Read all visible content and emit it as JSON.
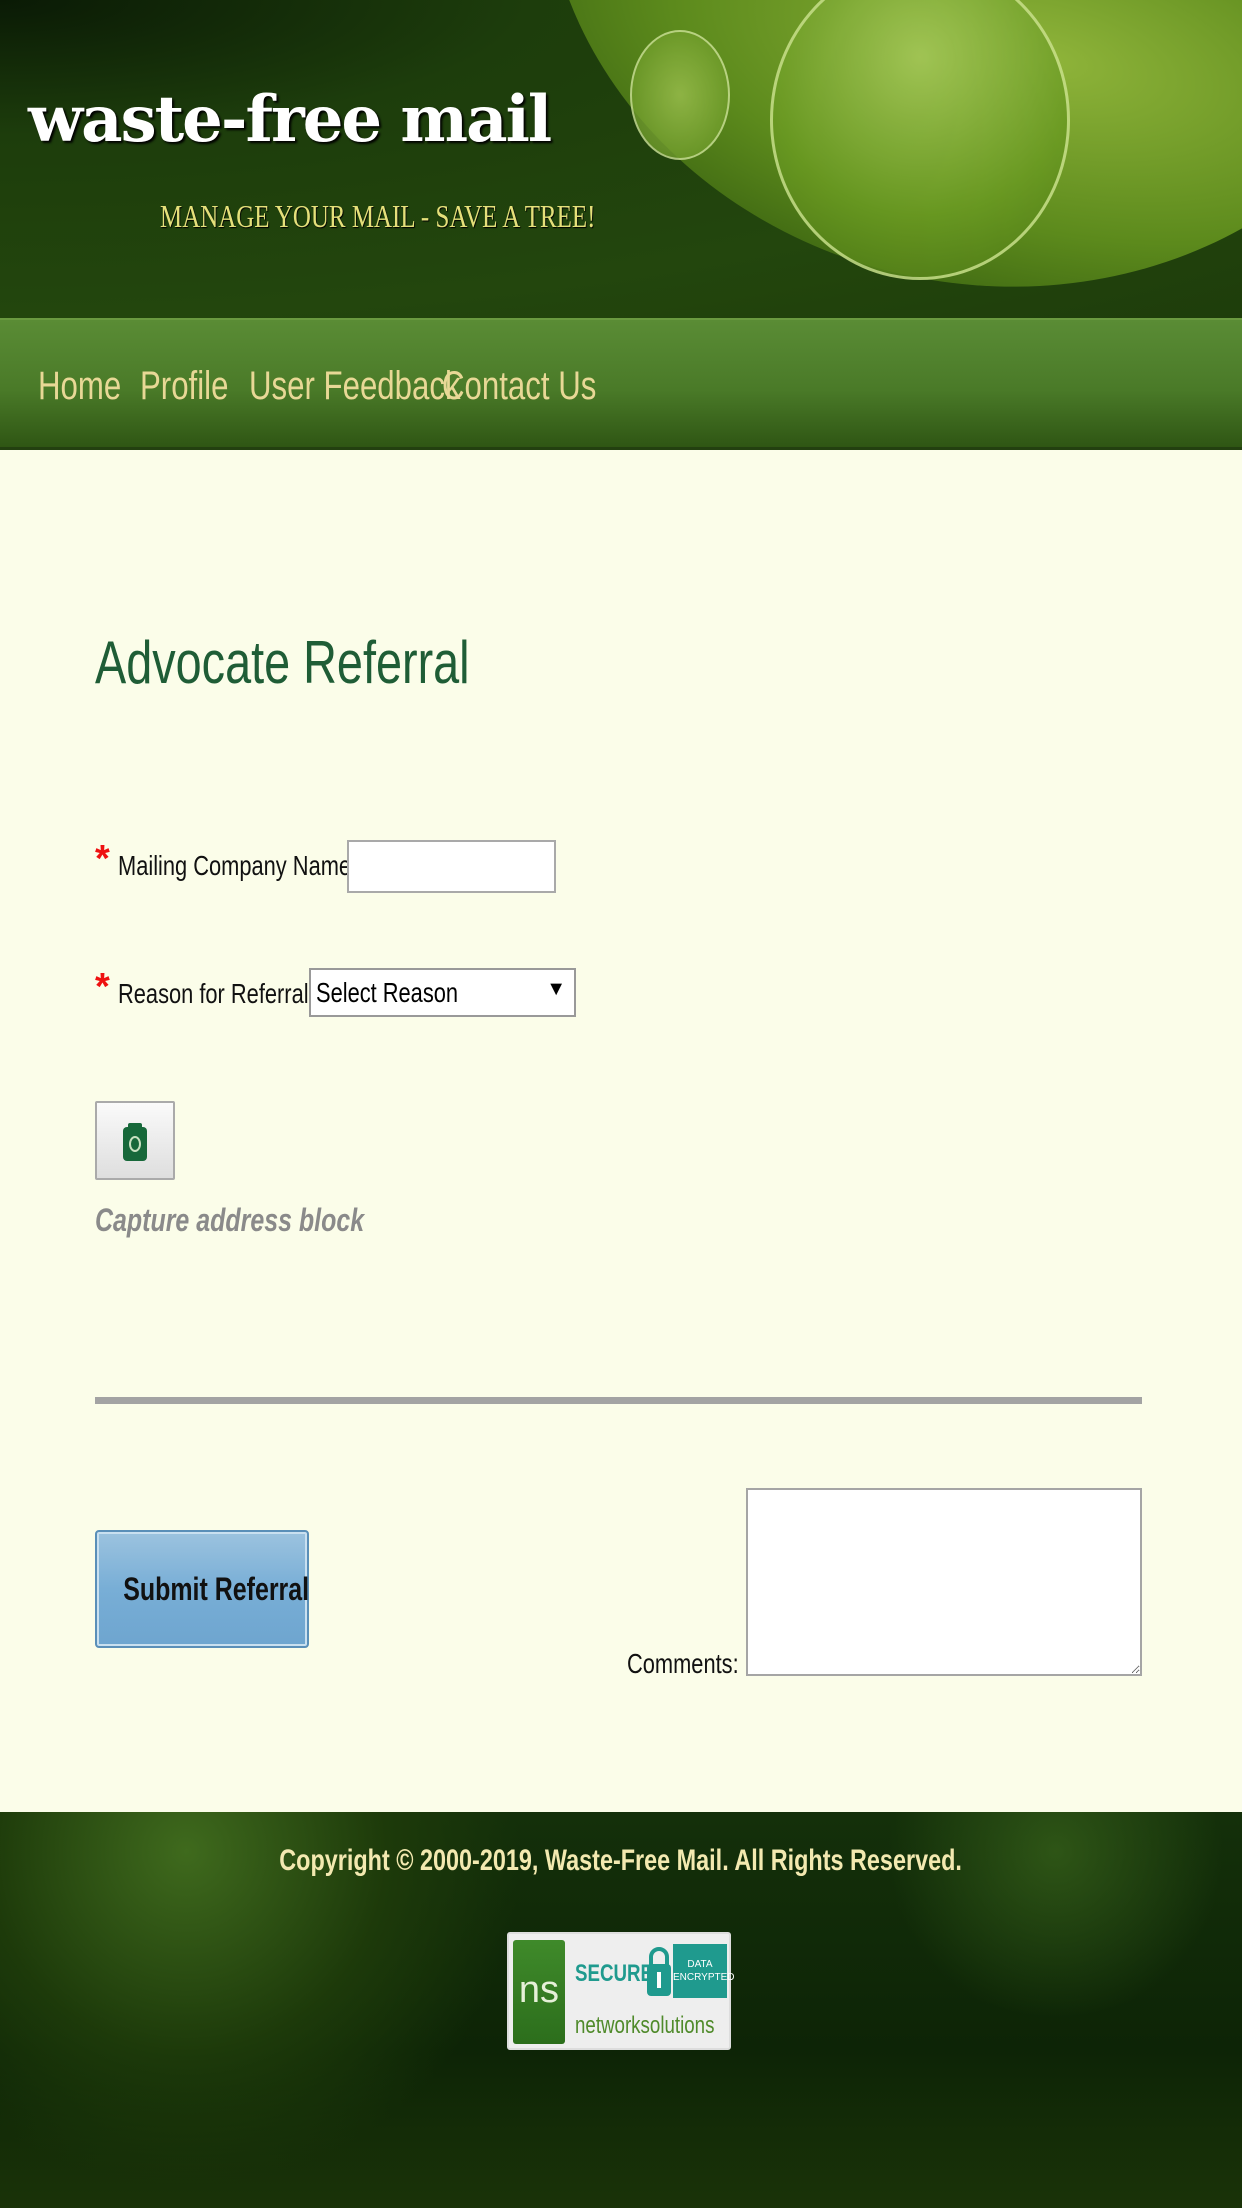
{
  "header": {
    "logo": "waste-free mail",
    "tagline": "MANAGE YOUR MAIL - SAVE A TREE!"
  },
  "nav": {
    "items": [
      {
        "label": "Home"
      },
      {
        "label": "Profile"
      },
      {
        "label": "User Feedback"
      },
      {
        "label": "Contact Us"
      }
    ]
  },
  "main": {
    "title": "Advocate Referral",
    "required_mark": "*",
    "company_label": "Mailing Company Name:",
    "company_value": "",
    "reason_label": "Reason for Referral:",
    "reason_selected": "Select Reason",
    "capture_caption": "Capture address block",
    "submit_label": "Submit Referral",
    "comments_label": "Comments:",
    "comments_value": ""
  },
  "footer": {
    "copyright": "Copyright © 2000-2019, Waste-Free Mail. All Rights Reserved.",
    "badge": {
      "secure": "SECURE",
      "encrypted": "DATA ENCRYPTED",
      "brand": "networksolutions",
      "logo": "ns"
    }
  },
  "colors": {
    "title": "#1f5d36",
    "nav_text": "#e8d896",
    "background": "#fbfde9",
    "required": "#ee1111"
  }
}
